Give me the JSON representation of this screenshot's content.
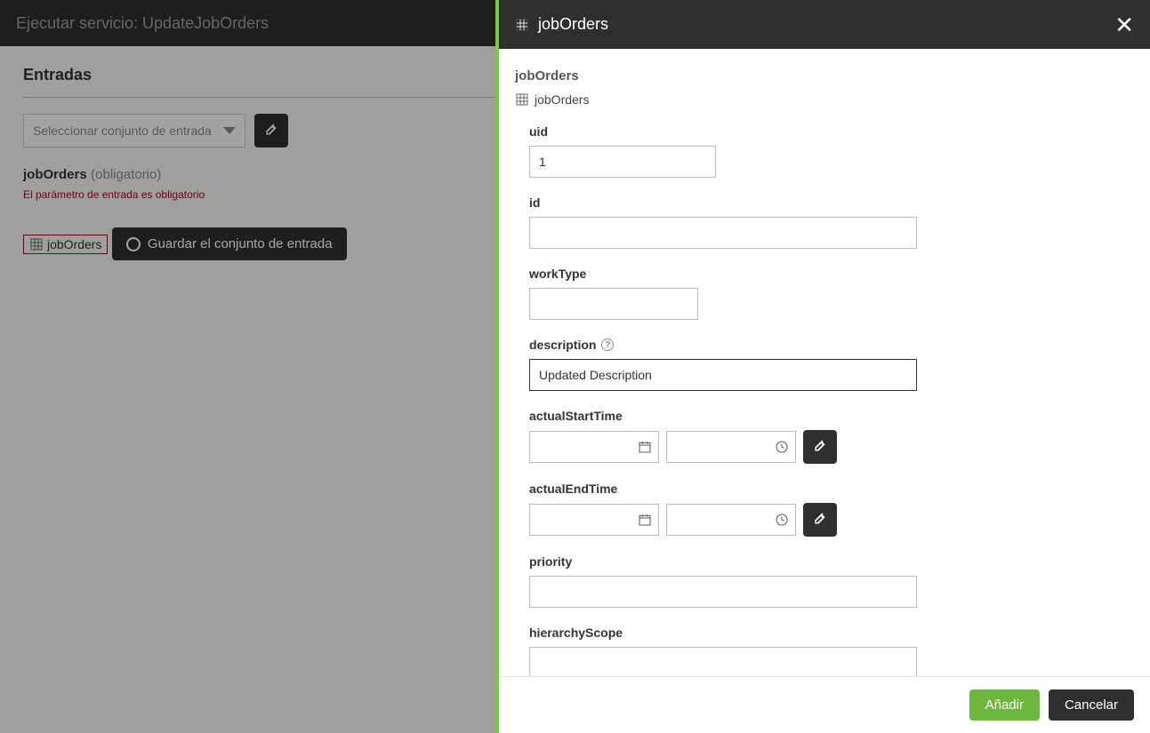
{
  "backdrop": {
    "title": "Ejecutar servicio: UpdateJobOrders",
    "section": "Entradas",
    "select_placeholder": "Seleccionar conjunto de entrada",
    "param_name": "jobOrders",
    "param_required": "(obligatorio)",
    "error": "El parámetro de entrada es obligatorio",
    "chip_label": "jobOrders",
    "save_button": "Guardar el conjunto de entrada"
  },
  "panel": {
    "title": "jobOrders",
    "crumb_top": "jobOrders",
    "crumb_item": "jobOrders",
    "fields": {
      "uid_label": "uid",
      "uid_value": "1",
      "id_label": "id",
      "id_value": "",
      "workType_label": "workType",
      "workType_value": "",
      "description_label": "description",
      "description_value": "Updated Description",
      "actualStartTime_label": "actualStartTime",
      "actualStartTime_date": "",
      "actualStartTime_time": "",
      "actualEndTime_label": "actualEndTime",
      "actualEndTime_date": "",
      "actualEndTime_time": "",
      "priority_label": "priority",
      "priority_value": "",
      "hierarchyScope_label": "hierarchyScope",
      "hierarchyScope_value": ""
    },
    "footer": {
      "add": "Añadir",
      "cancel": "Cancelar"
    }
  }
}
